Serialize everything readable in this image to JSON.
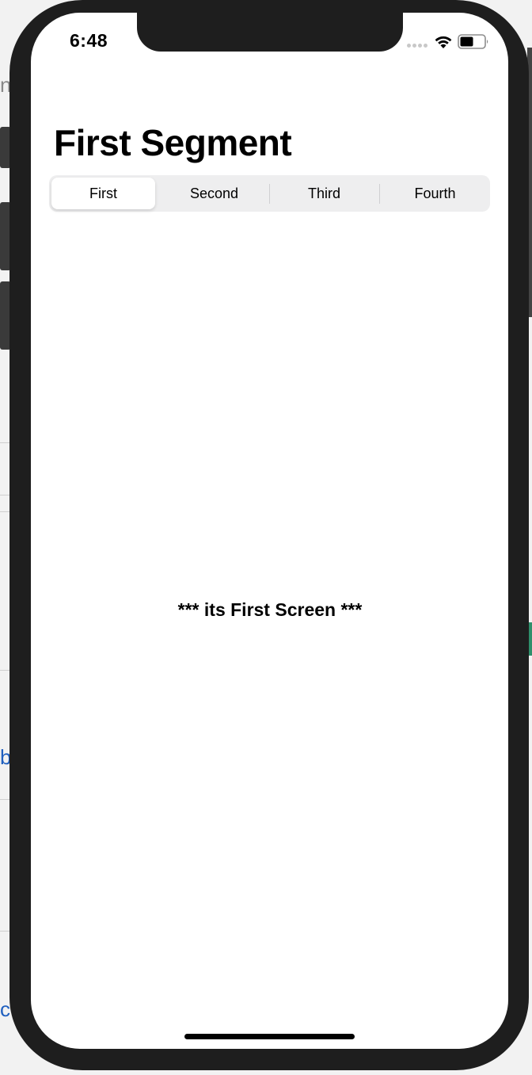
{
  "status_bar": {
    "time": "6:48",
    "icons": [
      "cellular-signal-icon",
      "wifi-icon",
      "battery-icon"
    ]
  },
  "navigation": {
    "title": "First Segment"
  },
  "segmented_control": {
    "selected_index": 0,
    "segments": [
      {
        "label": "First"
      },
      {
        "label": "Second"
      },
      {
        "label": "Third"
      },
      {
        "label": "Fourth"
      }
    ]
  },
  "content": {
    "message": "*** its First Screen ***"
  },
  "background_fragments": {
    "glyph_top": "n",
    "glyph_b": "b",
    "glyph_c": "c"
  },
  "colors": {
    "screen_background": "#ffffff",
    "segment_track": "#eeeeef",
    "selected_segment": "#ffffff",
    "phone_bezel": "#1e1e1e"
  }
}
